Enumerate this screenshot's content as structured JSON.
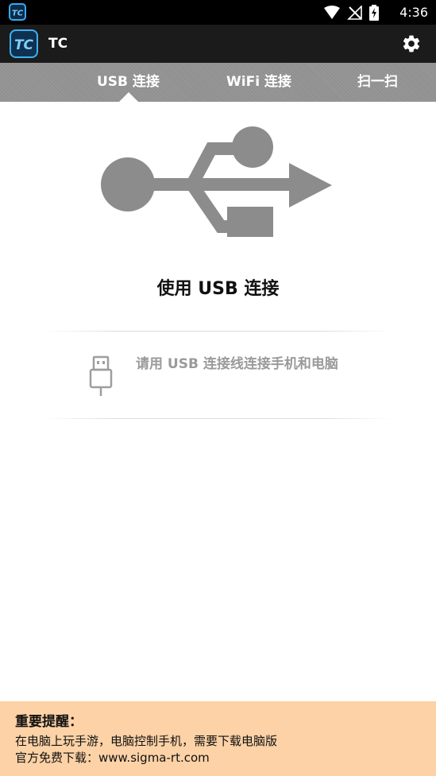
{
  "status_bar": {
    "time": "4:36",
    "icons": [
      "app-notification-icon",
      "wifi-icon",
      "no-signal-icon",
      "battery-charging-icon"
    ]
  },
  "app_bar": {
    "logo_text": "TC",
    "title": "TC",
    "settings_icon": "gear-icon"
  },
  "tabs": [
    {
      "label": "USB 连接",
      "selected": true
    },
    {
      "label": "WiFi 连接",
      "selected": false
    },
    {
      "label": "扫一扫",
      "selected": false
    }
  ],
  "main": {
    "hero_icon": "usb-symbol-icon",
    "mode_title": "使用 USB 连接",
    "hint_icon": "usb-plug-icon",
    "hint_text": "请用 USB 连接线连接手机和电脑"
  },
  "notice": {
    "title": "重要提醒：",
    "line1": "在电脑上玩手游，电脑控制手机，需要下载电脑版",
    "line2": "官方免费下载：www.sigma-rt.com"
  },
  "colors": {
    "status_bar": "#000000",
    "app_bar": "#1b1b1b",
    "tab_bar": "#909090",
    "logo_accent": "#3eb0f4",
    "hero_icon": "#8c8c8c",
    "notice_bg": "#fcd2a6"
  }
}
